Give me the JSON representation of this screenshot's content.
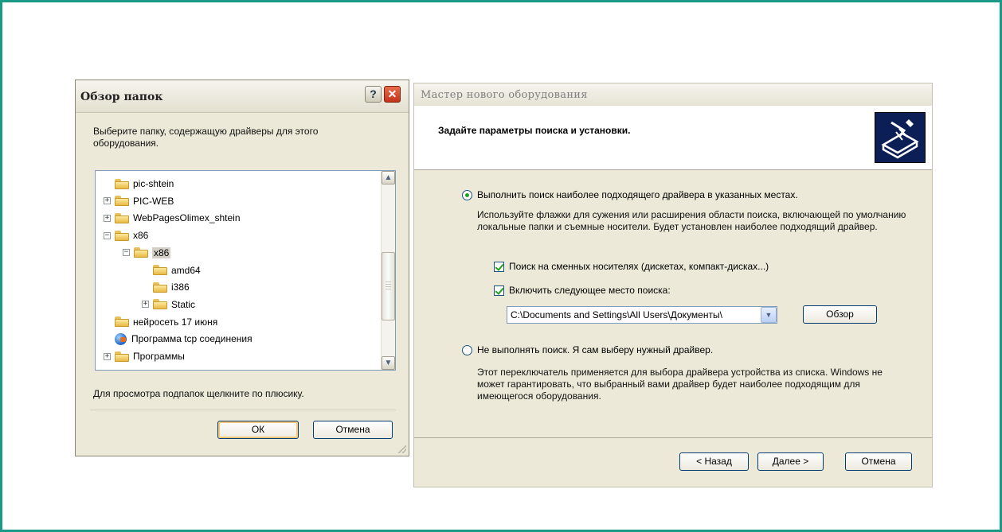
{
  "browse_dialog": {
    "title": "Обзор папок",
    "help_label": "?",
    "close_label": "✕",
    "instruction": "Выберите папку, содержащую драйверы для этого оборудования.",
    "tree": [
      {
        "label": "pic-shtein",
        "expander": "",
        "level": 0,
        "icon": "folder-icon"
      },
      {
        "label": "PIC-WEB",
        "expander": "+",
        "level": 0,
        "icon": "folder-icon"
      },
      {
        "label": "WebPagesOlimex_shtein",
        "expander": "+",
        "level": 0,
        "icon": "folder-icon"
      },
      {
        "label": "x86",
        "expander": "−",
        "level": 0,
        "icon": "folder-icon"
      },
      {
        "label": "x86",
        "expander": "−",
        "level": 1,
        "icon": "folder-open-icon",
        "selected": true
      },
      {
        "label": "amd64",
        "expander": "",
        "level": 2,
        "icon": "folder-icon"
      },
      {
        "label": "i386",
        "expander": "",
        "level": 2,
        "icon": "folder-icon"
      },
      {
        "label": "Static",
        "expander": "+",
        "level": 2,
        "icon": "folder-icon"
      },
      {
        "label": "нейросеть 17 июня",
        "expander": "",
        "level": 0,
        "icon": "folder-icon"
      },
      {
        "label": "Программа tcp соединения",
        "expander": "",
        "level": 0,
        "icon": "globe-icon"
      },
      {
        "label": "Программы",
        "expander": "+",
        "level": 0,
        "icon": "folder-icon"
      }
    ],
    "hint": "Для просмотра подпапок щелкните по плюсику.",
    "ok_label": "ОК",
    "cancel_label": "Отмена"
  },
  "wizard": {
    "title": "Мастер нового оборудования",
    "header_title": "Задайте параметры поиска и установки.",
    "option_search_label": "Выполнить поиск наиболее подходящего драйвера в указанных местах.",
    "option_search_selected": true,
    "option_search_desc": "Используйте флажки для сужения или расширения области поиска, включающей по умолчанию локальные папки и съемные носители. Будет установлен наиболее подходящий драйвер.",
    "check_removable_label": "Поиск на сменных носителях (дискетах, компакт-дисках...)",
    "check_removable_checked": true,
    "check_location_label": "Включить следующее место поиска:",
    "check_location_checked": true,
    "location_value": "C:\\Documents and Settings\\All Users\\Документы\\",
    "browse_label": "Обзор",
    "option_manual_label": "Не выполнять поиск. Я сам выберу нужный драйвер.",
    "option_manual_selected": false,
    "option_manual_desc": "Этот переключатель применяется для выбора драйвера устройства из списка. Windows не может гарантировать, что выбранный вами драйвер будет наиболее подходящим для имеющегося оборудования.",
    "back_label": "< Назад",
    "next_label": "Далее >",
    "cancel_label": "Отмена"
  },
  "colors": {
    "frame_border": "#1a9a86",
    "dialog_bg": "#ece9d8",
    "button_border": "#003c74",
    "check_mark": "#21a121"
  }
}
